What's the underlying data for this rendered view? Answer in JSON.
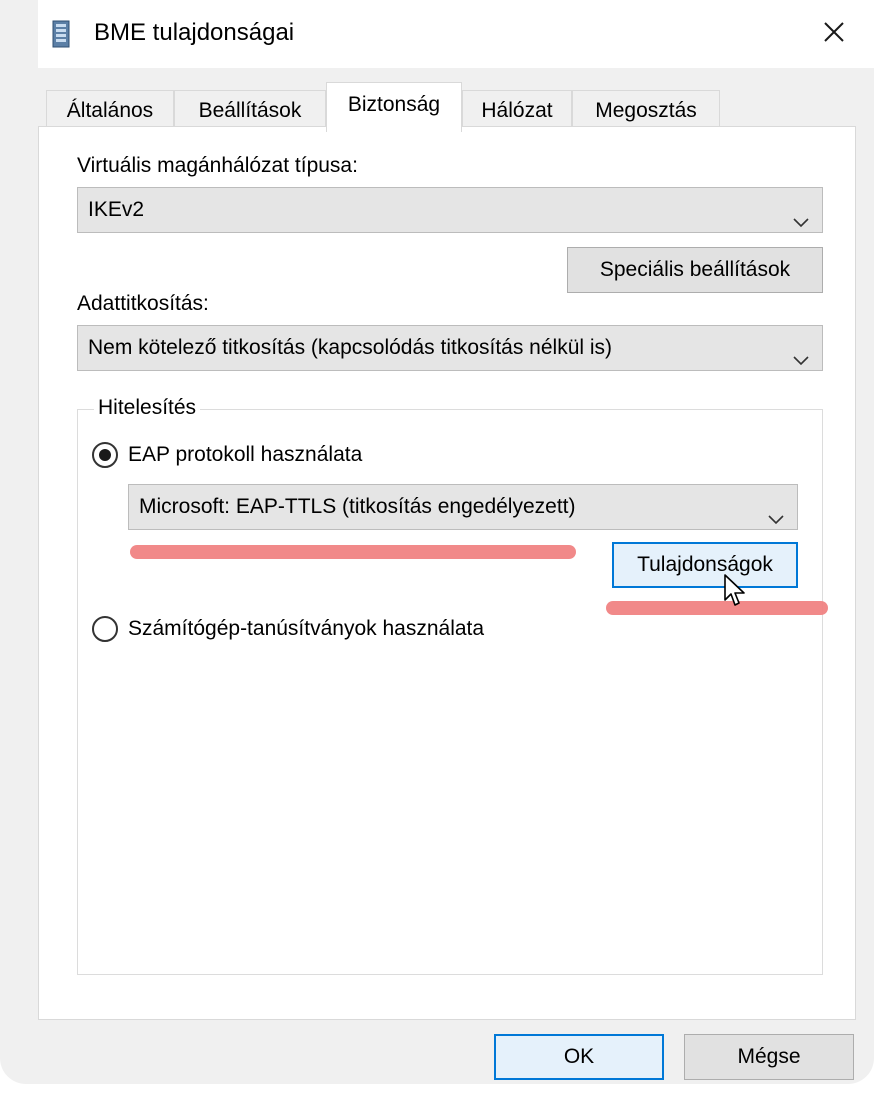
{
  "window": {
    "title": "BME tulajdonságai",
    "app_icon": "network-connection-icon",
    "close_icon": "close-icon"
  },
  "tabs": [
    {
      "label": "Általános",
      "active": false
    },
    {
      "label": "Beállítások",
      "active": false
    },
    {
      "label": "Biztonság",
      "active": true
    },
    {
      "label": "Hálózat",
      "active": false
    },
    {
      "label": "Megosztás",
      "active": false
    }
  ],
  "security": {
    "vpn_type_label": "Virtuális magánhálózat típusa:",
    "vpn_type_value": "IKEv2",
    "advanced_button": "Speciális beállítások",
    "encryption_label": "Adattitkosítás:",
    "encryption_value": "Nem kötelező titkosítás (kapcsolódás titkosítás nélkül is)",
    "auth_group": "Hitelesítés",
    "eap_radio": "EAP protokoll használata",
    "eap_selected": true,
    "eap_method_value": "Microsoft: EAP-TTLS (titkosítás engedélyezett)",
    "properties_button": "Tulajdonságok",
    "cert_radio": "Számítógép-tanúsítványok használata",
    "cert_selected": false
  },
  "footer": {
    "ok_label": "OK",
    "cancel_label": "Mégse"
  },
  "colors": {
    "annotation_red": "#f07f7f",
    "focus_blue": "#0078d7"
  }
}
